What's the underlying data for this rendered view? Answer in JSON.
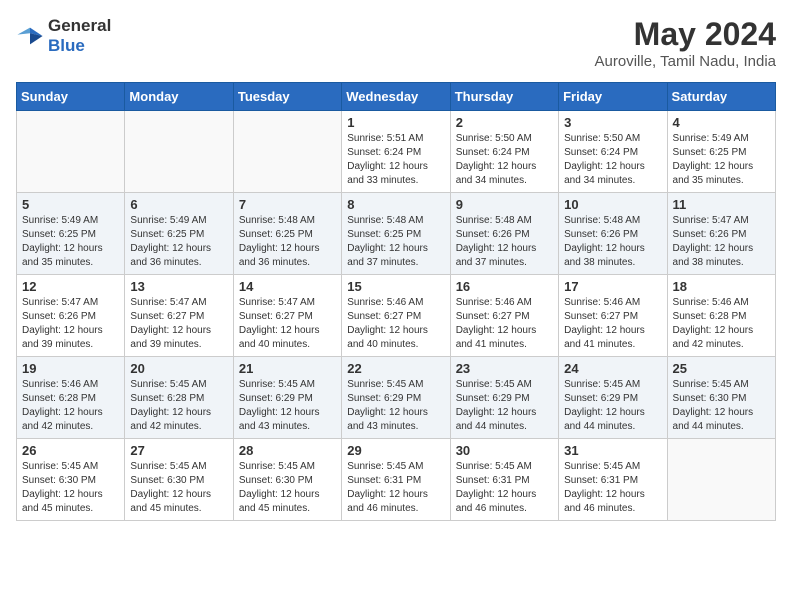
{
  "header": {
    "logo_line1": "General",
    "logo_line2": "Blue",
    "month_year": "May 2024",
    "location": "Auroville, Tamil Nadu, India"
  },
  "weekdays": [
    "Sunday",
    "Monday",
    "Tuesday",
    "Wednesday",
    "Thursday",
    "Friday",
    "Saturday"
  ],
  "weeks": [
    [
      {
        "day": "",
        "info": ""
      },
      {
        "day": "",
        "info": ""
      },
      {
        "day": "",
        "info": ""
      },
      {
        "day": "1",
        "info": "Sunrise: 5:51 AM\nSunset: 6:24 PM\nDaylight: 12 hours\nand 33 minutes."
      },
      {
        "day": "2",
        "info": "Sunrise: 5:50 AM\nSunset: 6:24 PM\nDaylight: 12 hours\nand 34 minutes."
      },
      {
        "day": "3",
        "info": "Sunrise: 5:50 AM\nSunset: 6:24 PM\nDaylight: 12 hours\nand 34 minutes."
      },
      {
        "day": "4",
        "info": "Sunrise: 5:49 AM\nSunset: 6:25 PM\nDaylight: 12 hours\nand 35 minutes."
      }
    ],
    [
      {
        "day": "5",
        "info": "Sunrise: 5:49 AM\nSunset: 6:25 PM\nDaylight: 12 hours\nand 35 minutes."
      },
      {
        "day": "6",
        "info": "Sunrise: 5:49 AM\nSunset: 6:25 PM\nDaylight: 12 hours\nand 36 minutes."
      },
      {
        "day": "7",
        "info": "Sunrise: 5:48 AM\nSunset: 6:25 PM\nDaylight: 12 hours\nand 36 minutes."
      },
      {
        "day": "8",
        "info": "Sunrise: 5:48 AM\nSunset: 6:25 PM\nDaylight: 12 hours\nand 37 minutes."
      },
      {
        "day": "9",
        "info": "Sunrise: 5:48 AM\nSunset: 6:26 PM\nDaylight: 12 hours\nand 37 minutes."
      },
      {
        "day": "10",
        "info": "Sunrise: 5:48 AM\nSunset: 6:26 PM\nDaylight: 12 hours\nand 38 minutes."
      },
      {
        "day": "11",
        "info": "Sunrise: 5:47 AM\nSunset: 6:26 PM\nDaylight: 12 hours\nand 38 minutes."
      }
    ],
    [
      {
        "day": "12",
        "info": "Sunrise: 5:47 AM\nSunset: 6:26 PM\nDaylight: 12 hours\nand 39 minutes."
      },
      {
        "day": "13",
        "info": "Sunrise: 5:47 AM\nSunset: 6:27 PM\nDaylight: 12 hours\nand 39 minutes."
      },
      {
        "day": "14",
        "info": "Sunrise: 5:47 AM\nSunset: 6:27 PM\nDaylight: 12 hours\nand 40 minutes."
      },
      {
        "day": "15",
        "info": "Sunrise: 5:46 AM\nSunset: 6:27 PM\nDaylight: 12 hours\nand 40 minutes."
      },
      {
        "day": "16",
        "info": "Sunrise: 5:46 AM\nSunset: 6:27 PM\nDaylight: 12 hours\nand 41 minutes."
      },
      {
        "day": "17",
        "info": "Sunrise: 5:46 AM\nSunset: 6:27 PM\nDaylight: 12 hours\nand 41 minutes."
      },
      {
        "day": "18",
        "info": "Sunrise: 5:46 AM\nSunset: 6:28 PM\nDaylight: 12 hours\nand 42 minutes."
      }
    ],
    [
      {
        "day": "19",
        "info": "Sunrise: 5:46 AM\nSunset: 6:28 PM\nDaylight: 12 hours\nand 42 minutes."
      },
      {
        "day": "20",
        "info": "Sunrise: 5:45 AM\nSunset: 6:28 PM\nDaylight: 12 hours\nand 42 minutes."
      },
      {
        "day": "21",
        "info": "Sunrise: 5:45 AM\nSunset: 6:29 PM\nDaylight: 12 hours\nand 43 minutes."
      },
      {
        "day": "22",
        "info": "Sunrise: 5:45 AM\nSunset: 6:29 PM\nDaylight: 12 hours\nand 43 minutes."
      },
      {
        "day": "23",
        "info": "Sunrise: 5:45 AM\nSunset: 6:29 PM\nDaylight: 12 hours\nand 44 minutes."
      },
      {
        "day": "24",
        "info": "Sunrise: 5:45 AM\nSunset: 6:29 PM\nDaylight: 12 hours\nand 44 minutes."
      },
      {
        "day": "25",
        "info": "Sunrise: 5:45 AM\nSunset: 6:30 PM\nDaylight: 12 hours\nand 44 minutes."
      }
    ],
    [
      {
        "day": "26",
        "info": "Sunrise: 5:45 AM\nSunset: 6:30 PM\nDaylight: 12 hours\nand 45 minutes."
      },
      {
        "day": "27",
        "info": "Sunrise: 5:45 AM\nSunset: 6:30 PM\nDaylight: 12 hours\nand 45 minutes."
      },
      {
        "day": "28",
        "info": "Sunrise: 5:45 AM\nSunset: 6:30 PM\nDaylight: 12 hours\nand 45 minutes."
      },
      {
        "day": "29",
        "info": "Sunrise: 5:45 AM\nSunset: 6:31 PM\nDaylight: 12 hours\nand 46 minutes."
      },
      {
        "day": "30",
        "info": "Sunrise: 5:45 AM\nSunset: 6:31 PM\nDaylight: 12 hours\nand 46 minutes."
      },
      {
        "day": "31",
        "info": "Sunrise: 5:45 AM\nSunset: 6:31 PM\nDaylight: 12 hours\nand 46 minutes."
      },
      {
        "day": "",
        "info": ""
      }
    ]
  ]
}
